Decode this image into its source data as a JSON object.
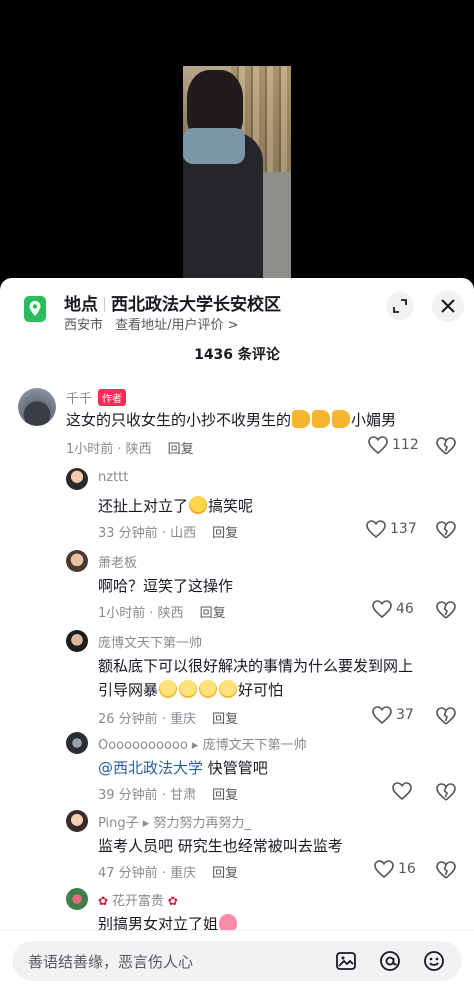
{
  "location": {
    "label": "地点",
    "place": "西北政法大学长安校区",
    "city": "西安市",
    "link": "查看地址/用户评价 >"
  },
  "comment_count": "1436 条评论",
  "comments": [
    {
      "author": "千千",
      "badge": "作者",
      "text_a": "这女的只收女生的小抄不收男生的",
      "text_b": "小媚男",
      "meta": "1小时前 · 陕西",
      "reply": "回复",
      "likes": "112"
    },
    {
      "author": "nzttt",
      "text_a": "还扯上对立了",
      "text_b": "搞笑呢",
      "meta": "33 分钟前 · 山西",
      "reply": "回复",
      "likes": "137"
    },
    {
      "author": "萧老板",
      "text_a": "啊哈？逗笑了这操作",
      "meta": "1小时前 · 陕西",
      "reply": "回复",
      "likes": "46"
    },
    {
      "author": "庞博文天下第一帅",
      "text_line1": "额私底下可以很好解决的事情为什么要发到网上",
      "text_a": "引导网暴",
      "text_b": "好可怕",
      "meta": "26 分钟前 · 重庆",
      "reply": "回复",
      "likes": "37"
    },
    {
      "author": "Ooooooooooo",
      "reply_to": "庞博文天下第一帅",
      "mention": "@西北政法大学",
      "text_b": " 快管管吧",
      "meta": "39 分钟前 · 甘肃",
      "reply": "回复",
      "likes": ""
    },
    {
      "author": "Ping子",
      "reply_to": "努力努力再努力_",
      "text_a": "监考人员吧 研究生也经常被叫去监考",
      "meta": "47 分钟前 · 重庆",
      "reply": "回复",
      "likes": "16"
    },
    {
      "author": "花开富贵",
      "text_a": "别搞男女对立了姐"
    }
  ],
  "input": {
    "placeholder": "善语结善缘，恶言伤人心"
  },
  "icons": {
    "pin": "map-pin-icon",
    "expand": "expand-icon",
    "close": "close-icon",
    "heart": "heart-icon",
    "dislike": "broken-heart-icon",
    "image": "image-icon",
    "at": "at-icon",
    "emoji": "emoji-icon"
  },
  "colors": {
    "accent": "#fe2c55",
    "pin_green": "#2dbb5d",
    "mention": "#2a5f9e"
  }
}
